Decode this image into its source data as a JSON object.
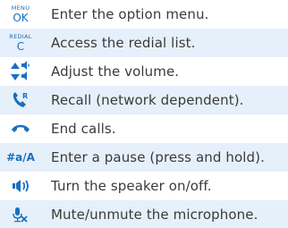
{
  "rows": [
    {
      "key_small": "MENU",
      "key_large": "OK",
      "icon": "menu-ok-key-icon",
      "text": "Enter the option menu.",
      "shaded": false
    },
    {
      "key_small": "REDIAL",
      "key_large": "C",
      "icon": "redial-c-key-icon",
      "text": "Access the redial list.",
      "shaded": true
    },
    {
      "icon": "volume-navigation-icon",
      "text": "Adjust the volume.",
      "shaded": false
    },
    {
      "icon": "recall-icon",
      "text": "Recall (network dependent).",
      "shaded": true
    },
    {
      "icon": "end-call-icon",
      "text": "End calls.",
      "shaded": false
    },
    {
      "key_label": "#a/A",
      "icon": "pause-key-icon",
      "text": "Enter a pause (press and hold).",
      "shaded": true
    },
    {
      "icon": "speaker-icon",
      "text": "Turn the speaker on/off.",
      "shaded": false
    },
    {
      "icon": "mute-microphone-icon",
      "text": "Mute/unmute the microphone.",
      "shaded": true
    }
  ],
  "colors": {
    "accent": "#1a6fc0",
    "row_shade": "#e6f0fa",
    "text": "#3a3a3a"
  }
}
